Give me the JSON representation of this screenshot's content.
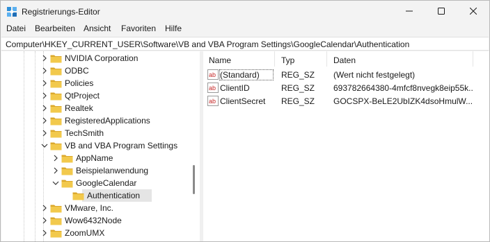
{
  "window": {
    "title": "Registrierungs-Editor",
    "icon": "regedit-icon",
    "controls": [
      "minimize-icon",
      "maximize-icon",
      "close-icon"
    ]
  },
  "menu": {
    "items": [
      "Datei",
      "Bearbeiten",
      "Ansicht",
      "Favoriten",
      "Hilfe"
    ]
  },
  "address": {
    "path": "Computer\\HKEY_CURRENT_USER\\Software\\VB and VBA Program Settings\\GoogleCalendar\\Authentication"
  },
  "tree": {
    "items": [
      {
        "label": "NVIDIA Corporation",
        "level": 0,
        "expanded": false,
        "selected": false
      },
      {
        "label": "ODBC",
        "level": 0,
        "expanded": false,
        "selected": false
      },
      {
        "label": "Policies",
        "level": 0,
        "expanded": false,
        "selected": false
      },
      {
        "label": "QtProject",
        "level": 0,
        "expanded": false,
        "selected": false
      },
      {
        "label": "Realtek",
        "level": 0,
        "expanded": false,
        "selected": false
      },
      {
        "label": "RegisteredApplications",
        "level": 0,
        "expanded": false,
        "selected": false
      },
      {
        "label": "TechSmith",
        "level": 0,
        "expanded": false,
        "selected": false
      },
      {
        "label": "VB and VBA Program Settings",
        "level": 0,
        "expanded": true,
        "selected": false
      },
      {
        "label": "AppName",
        "level": 1,
        "expanded": false,
        "selected": false
      },
      {
        "label": "Beispielanwendung",
        "level": 1,
        "expanded": false,
        "selected": false
      },
      {
        "label": "GoogleCalendar",
        "level": 1,
        "expanded": true,
        "selected": false
      },
      {
        "label": "Authentication",
        "level": 2,
        "expanded": false,
        "selected": true,
        "leaf": true
      },
      {
        "label": "VMware, Inc.",
        "level": 0,
        "expanded": false,
        "selected": false
      },
      {
        "label": "Wow6432Node",
        "level": 0,
        "expanded": false,
        "selected": false
      },
      {
        "label": "ZoomUMX",
        "level": 0,
        "expanded": false,
        "selected": false
      }
    ]
  },
  "values": {
    "columns": [
      "Name",
      "Typ",
      "Daten"
    ],
    "rows": [
      {
        "name": "(Standard)",
        "type": "REG_SZ",
        "data": "(Wert nicht festgelegt)"
      },
      {
        "name": "ClientID",
        "type": "REG_SZ",
        "data": "693782664380-4mfcf8nvegk8eip55k..."
      },
      {
        "name": "ClientSecret",
        "type": "REG_SZ",
        "data": "GOCSPX-BeLE2UbIZK4dsoHmulW..."
      }
    ],
    "icon": "string-value-icon"
  },
  "colors": {
    "folder": "#f2c94c",
    "folder_dark": "#dba82c",
    "selection": "#e5e5e5",
    "value_icon_red": "#c62828"
  }
}
